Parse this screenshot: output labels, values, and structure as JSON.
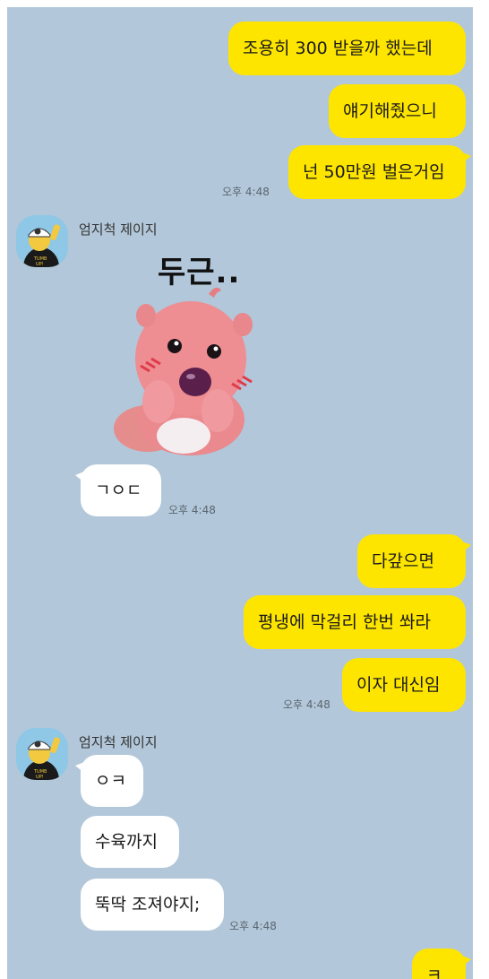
{
  "messages": {
    "me1": "조용히 300 받을까 했는데",
    "me2": "얘기해줬으니",
    "me3": "넌 50만원 벌은거임",
    "time1": "오후 4:48",
    "sender1": "엄지척 제이지",
    "sticker_text": "두근..",
    "other1": "ㄱㅇㄷ",
    "time2": "오후 4:48",
    "me4": "다갚으면",
    "me5": "평냉에 막걸리 한번 쏴라",
    "me6": "이자 대신임",
    "time3": "오후 4:48",
    "sender2": "엄지척 제이지",
    "other2": "ㅇㅋ",
    "other3": "수육까지",
    "other4": "뚝딱 조져야지;",
    "time4": "오후 4:48",
    "me7": "ㅋ"
  },
  "colors": {
    "background": "#b2c7d9",
    "my_bubble": "#fee500",
    "other_bubble": "#ffffff"
  }
}
